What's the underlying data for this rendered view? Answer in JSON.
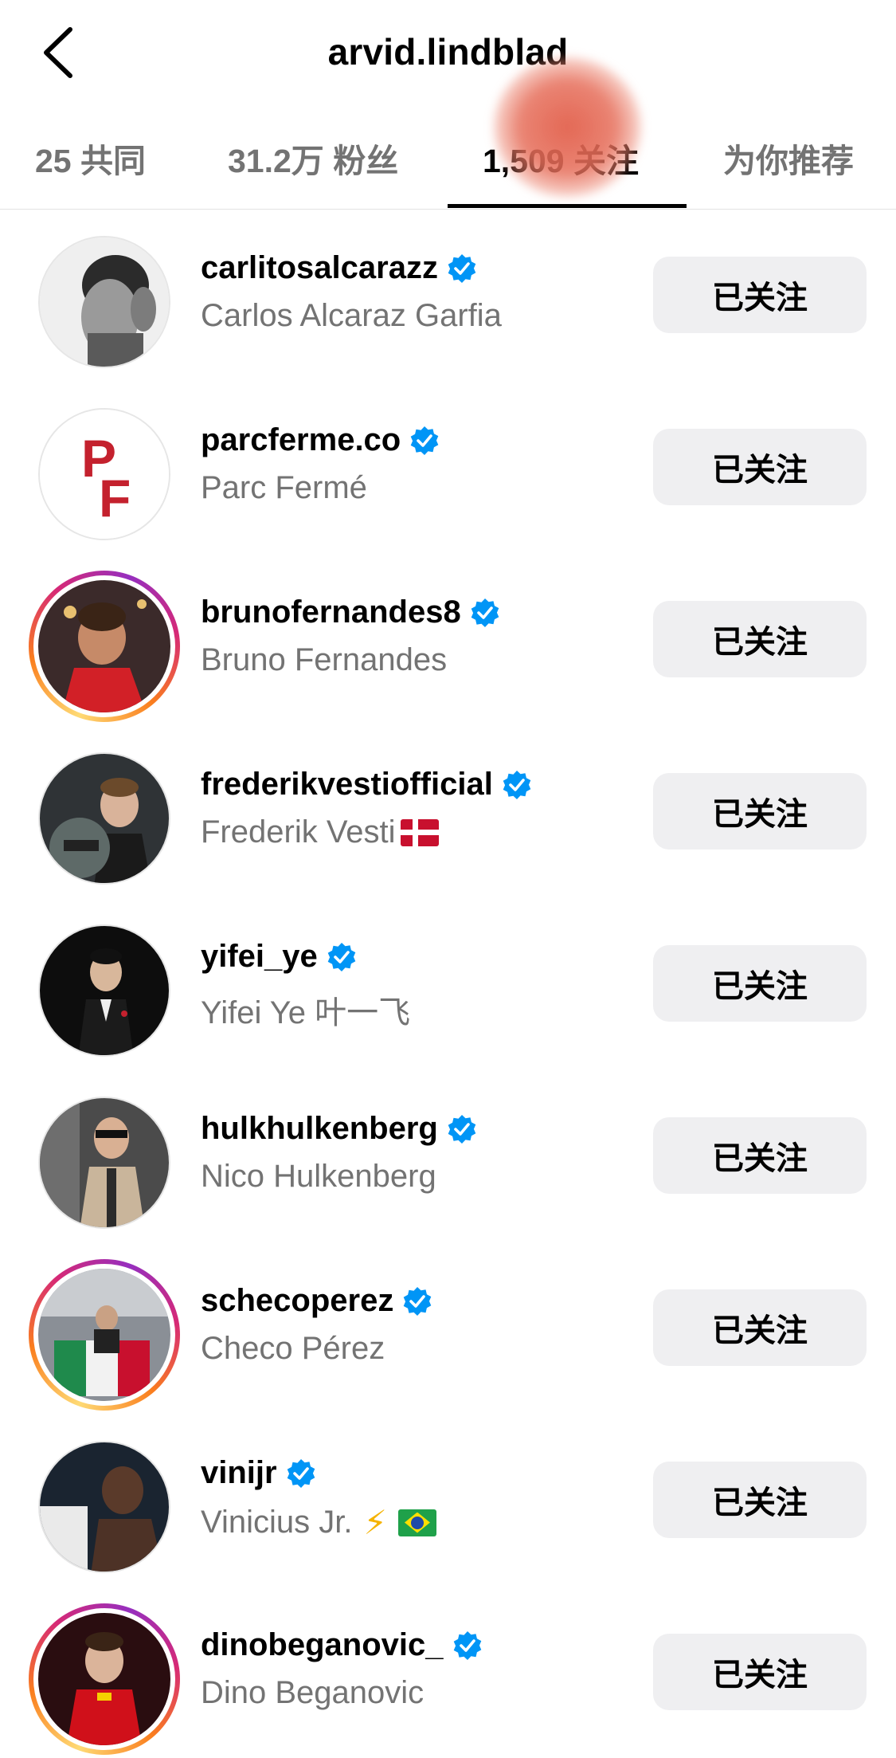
{
  "header": {
    "title": "arvid.lindblad"
  },
  "tabs": [
    {
      "label": "25 共同",
      "active": false
    },
    {
      "label": "31.2万 粉丝",
      "active": false
    },
    {
      "label": "1,509 关注",
      "active": true
    },
    {
      "label": "为你推荐",
      "active": false
    }
  ],
  "colors": {
    "verified": "#0095f6",
    "button_bg": "#efeff1",
    "secondary_text": "#737373"
  },
  "following": [
    {
      "username": "carlitosalcarazz",
      "full_name": "Carlos Alcaraz Garfia",
      "verified": true,
      "story_ring": false,
      "button": "已关注"
    },
    {
      "username": "parcferme.co",
      "full_name": "Parc Fermé",
      "verified": true,
      "story_ring": false,
      "button": "已关注",
      "avatar_text": "PF"
    },
    {
      "username": "brunofernandes8",
      "full_name": "Bruno Fernandes",
      "verified": true,
      "story_ring": true,
      "button": "已关注"
    },
    {
      "username": "frederikvestiofficial",
      "full_name": "Frederik Vesti",
      "verified": true,
      "story_ring": false,
      "button": "已关注",
      "emoji": "denmark-flag"
    },
    {
      "username": "yifei_ye",
      "full_name": "Yifei Ye  叶一飞",
      "verified": true,
      "story_ring": false,
      "button": "已关注"
    },
    {
      "username": "hulkhulkenberg",
      "full_name": "Nico Hulkenberg",
      "verified": true,
      "story_ring": false,
      "button": "已关注"
    },
    {
      "username": "schecoperez",
      "full_name": "Checo Pérez",
      "verified": true,
      "story_ring": true,
      "button": "已关注"
    },
    {
      "username": "vinijr",
      "full_name": "Vinicius Jr.",
      "verified": true,
      "story_ring": false,
      "button": "已关注",
      "emoji": "lightning-brazil-flag"
    },
    {
      "username": "dinobeganovic_",
      "full_name": "Dino Beganovic",
      "verified": true,
      "story_ring": true,
      "button": "已关注"
    }
  ]
}
